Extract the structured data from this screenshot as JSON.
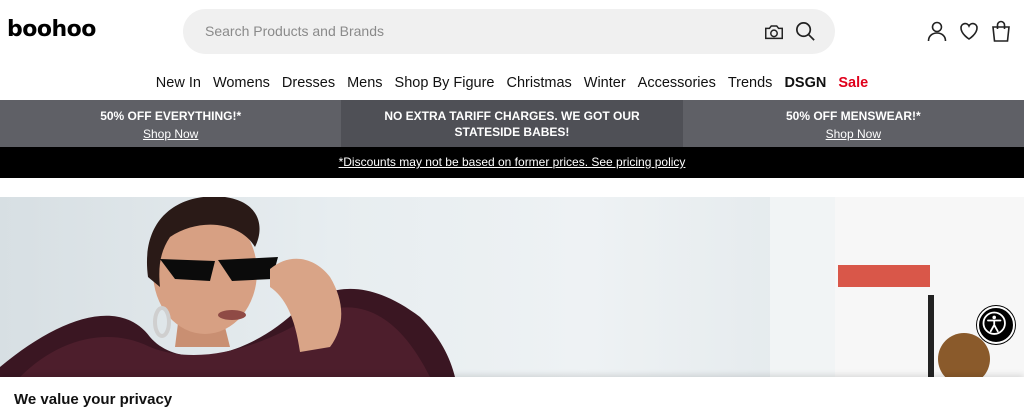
{
  "header": {
    "logo": "boohoo",
    "search_placeholder": "Search Products and Brands",
    "icons": [
      "camera-icon",
      "search-icon",
      "account-icon",
      "heart-icon",
      "bag-icon"
    ]
  },
  "nav": {
    "items": [
      "New In",
      "Womens",
      "Dresses",
      "Mens",
      "Shop By Figure",
      "Christmas",
      "Winter",
      "Accessories",
      "Trends"
    ],
    "dsgn": "DSGN",
    "sale": "Sale"
  },
  "promo": {
    "left_title": "50% OFF EVERYTHING!*",
    "left_link": "Shop Now",
    "mid_title": "NO EXTRA TARIFF CHARGES. WE GOT OUR STATESIDE BABES!",
    "right_title": "50% OFF MENSWEAR!*",
    "right_link": "Shop Now"
  },
  "disclaimer": "*Discounts may not be based on former prices. See pricing policy",
  "privacy": {
    "title": "We value your privacy"
  },
  "colors": {
    "promo_bg": "#5f6066",
    "sale": "#e0001b",
    "disclaimer_bg": "#000000"
  }
}
